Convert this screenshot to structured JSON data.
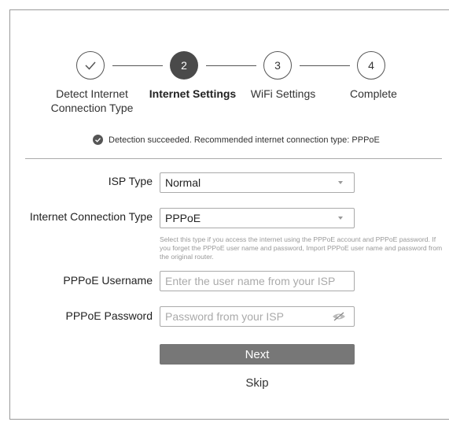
{
  "stepper": {
    "steps": [
      {
        "number": "",
        "label_line1": "Detect Internet",
        "label_line2": "Connection Type",
        "state": "done"
      },
      {
        "number": "2",
        "label_line1": "Internet Settings",
        "label_line2": "",
        "state": "active"
      },
      {
        "number": "3",
        "label_line1": "WiFi Settings",
        "label_line2": "",
        "state": "pending"
      },
      {
        "number": "4",
        "label_line1": "Complete",
        "label_line2": "",
        "state": "pending"
      }
    ]
  },
  "detection": {
    "message": "Detection succeeded. Recommended internet connection type: PPPoE"
  },
  "form": {
    "isp_type": {
      "label": "ISP Type",
      "value": "Normal"
    },
    "connection_type": {
      "label": "Internet Connection Type",
      "value": "PPPoE",
      "help": "Select this type if you access the internet using the PPPoE account and PPPoE password. If you forget the PPPoE user name and password, Import PPPoE user name and password from the original router."
    },
    "username": {
      "label": "PPPoE Username",
      "placeholder": "Enter the user name from your ISP"
    },
    "password": {
      "label": "PPPoE Password",
      "placeholder": "Password from your ISP"
    }
  },
  "actions": {
    "next_label": "Next",
    "skip_label": "Skip"
  },
  "colors": {
    "active_step": "#4a4a4a",
    "button": "#777777",
    "border": "#aaaaaa"
  }
}
